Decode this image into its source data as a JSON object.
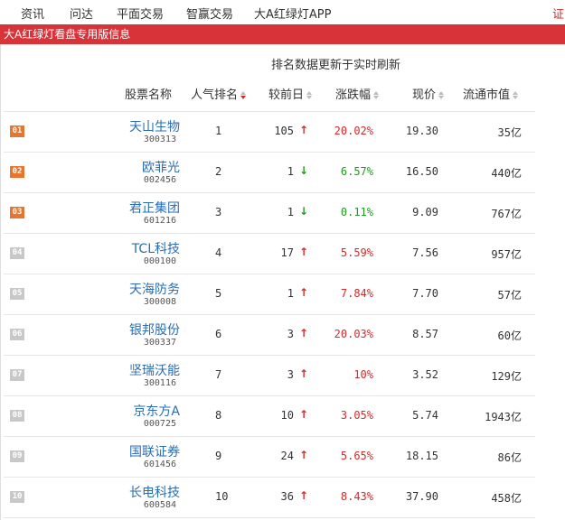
{
  "nav": {
    "items": [
      "资讯",
      "问达",
      "平面交易",
      "智赢交易",
      "大A红绿灯APP"
    ],
    "edge_text": "证"
  },
  "banner": {
    "text": "大A红绿灯看盘专用版信息"
  },
  "table": {
    "update_note": "排名数据更新于实时刷新",
    "headers": {
      "name": "股票名称",
      "popularity": "人气排名",
      "prev_day": "较前日",
      "change": "涨跌幅",
      "price": "现价",
      "market_cap": "流通市值"
    },
    "colors": {
      "up": "#d12b2b",
      "down": "#229922",
      "top_badge": "#e8742e",
      "other_badge": "#c8c8c8",
      "link": "#2a6db3"
    },
    "rows": [
      {
        "rank": "01",
        "name": "天山生物",
        "code": "300313",
        "popularity": "1",
        "prev": "105",
        "trend": "up",
        "change": "20.02%",
        "price": "19.30",
        "cap": "35亿"
      },
      {
        "rank": "02",
        "name": "欧菲光",
        "code": "002456",
        "popularity": "2",
        "prev": "1",
        "trend": "down",
        "change": "6.57%",
        "price": "16.50",
        "cap": "440亿"
      },
      {
        "rank": "03",
        "name": "君正集团",
        "code": "601216",
        "popularity": "3",
        "prev": "1",
        "trend": "down",
        "change": "0.11%",
        "price": "9.09",
        "cap": "767亿"
      },
      {
        "rank": "04",
        "name": "TCL科技",
        "code": "000100",
        "popularity": "4",
        "prev": "17",
        "trend": "up",
        "change": "5.59%",
        "price": "7.56",
        "cap": "957亿"
      },
      {
        "rank": "05",
        "name": "天海防务",
        "code": "300008",
        "popularity": "5",
        "prev": "1",
        "trend": "up",
        "change": "7.84%",
        "price": "7.70",
        "cap": "57亿"
      },
      {
        "rank": "06",
        "name": "银邦股份",
        "code": "300337",
        "popularity": "6",
        "prev": "3",
        "trend": "up",
        "change": "20.03%",
        "price": "8.57",
        "cap": "60亿"
      },
      {
        "rank": "07",
        "name": "坚瑞沃能",
        "code": "300116",
        "popularity": "7",
        "prev": "3",
        "trend": "up",
        "change": "10%",
        "price": "3.52",
        "cap": "129亿"
      },
      {
        "rank": "08",
        "name": "京东方A",
        "code": "000725",
        "popularity": "8",
        "prev": "10",
        "trend": "up",
        "change": "3.05%",
        "price": "5.74",
        "cap": "1943亿"
      },
      {
        "rank": "09",
        "name": "国联证券",
        "code": "601456",
        "popularity": "9",
        "prev": "24",
        "trend": "up",
        "change": "5.65%",
        "price": "18.15",
        "cap": "86亿"
      },
      {
        "rank": "10",
        "name": "长电科技",
        "code": "600584",
        "popularity": "10",
        "prev": "36",
        "trend": "up",
        "change": "8.43%",
        "price": "37.90",
        "cap": "458亿"
      }
    ]
  }
}
